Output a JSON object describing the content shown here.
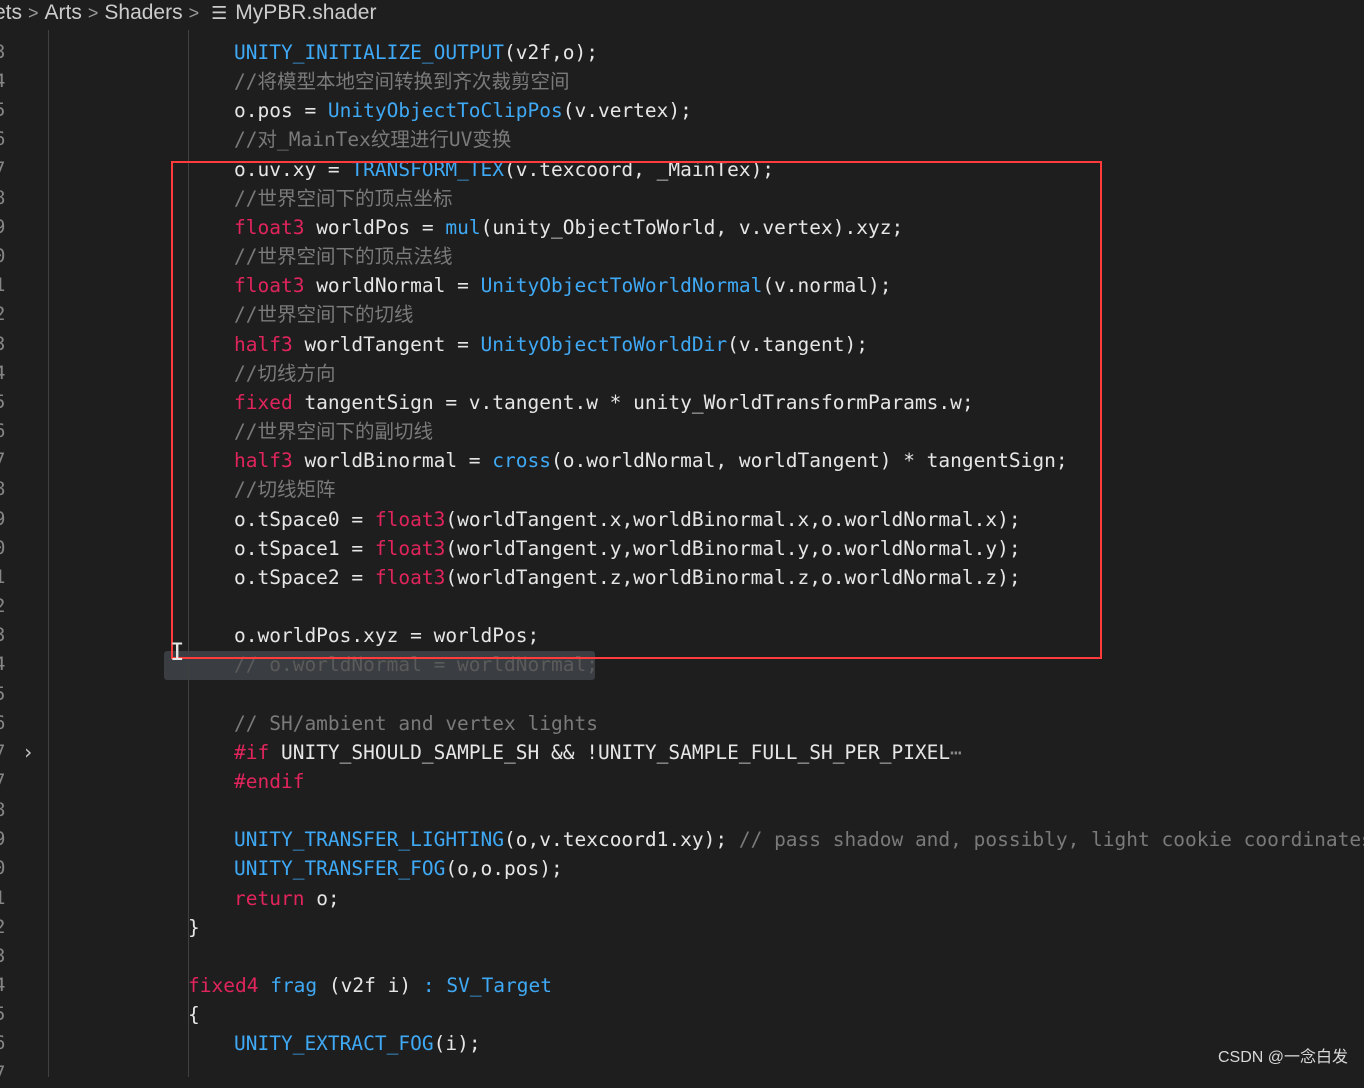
{
  "breadcrumb": {
    "items": [
      "ets",
      "Arts",
      "Shaders"
    ],
    "separator": ">",
    "file_icon": "list-file-icon",
    "file": "MyPBR.shader"
  },
  "gutter": {
    "numbers": [
      "3",
      "4",
      "5",
      "6",
      "7",
      "8",
      "9",
      "0",
      "1",
      "2",
      "3",
      "4",
      "5",
      "6",
      "7",
      "8",
      "9",
      "0",
      "1",
      "2",
      "3",
      "4",
      "5",
      "6",
      "7",
      "7",
      "8",
      "9",
      "0",
      "1",
      "2",
      "3",
      "4",
      "5",
      "6",
      "7"
    ],
    "fold_icon": "chevron-right-icon"
  },
  "code": {
    "lines": [
      [
        [
          "f",
          "UNITY_INITIALIZE_OUTPUT"
        ],
        [
          "p",
          "(v2f,o);"
        ]
      ],
      [
        [
          "c",
          "//将模型本地空间转换到齐次裁剪空间"
        ]
      ],
      [
        [
          "p",
          "o.pos = "
        ],
        [
          "f",
          "UnityObjectToClipPos"
        ],
        [
          "p",
          "(v.vertex);"
        ]
      ],
      [
        [
          "c",
          "//对_MainTex纹理进行UV变换"
        ]
      ],
      [
        [
          "p",
          "o.uv.xy = "
        ],
        [
          "f",
          "TRANSFORM_TEX"
        ],
        [
          "p",
          "(v.texcoord, _MainTex);"
        ]
      ],
      [
        [
          "c",
          "//世界空间下的顶点坐标"
        ]
      ],
      [
        [
          "k",
          "float3"
        ],
        [
          "p",
          " worldPos = "
        ],
        [
          "f",
          "mul"
        ],
        [
          "p",
          "(unity_ObjectToWorld, v.vertex).xyz;"
        ]
      ],
      [
        [
          "c",
          "//世界空间下的顶点法线"
        ]
      ],
      [
        [
          "k",
          "float3"
        ],
        [
          "p",
          " worldNormal = "
        ],
        [
          "f",
          "UnityObjectToWorldNormal"
        ],
        [
          "p",
          "(v.normal);"
        ]
      ],
      [
        [
          "c",
          "//世界空间下的切线"
        ]
      ],
      [
        [
          "k",
          "half3"
        ],
        [
          "p",
          " worldTangent = "
        ],
        [
          "f",
          "UnityObjectToWorldDir"
        ],
        [
          "p",
          "(v.tangent);"
        ]
      ],
      [
        [
          "c",
          "//切线方向"
        ]
      ],
      [
        [
          "k",
          "fixed"
        ],
        [
          "p",
          " tangentSign = v.tangent.w * unity_WorldTransformParams.w;"
        ]
      ],
      [
        [
          "c",
          "//世界空间下的副切线"
        ]
      ],
      [
        [
          "k",
          "half3"
        ],
        [
          "p",
          " worldBinormal = "
        ],
        [
          "f",
          "cross"
        ],
        [
          "p",
          "(o.worldNormal, worldTangent) * tangentSign;"
        ]
      ],
      [
        [
          "c",
          "//切线矩阵"
        ]
      ],
      [
        [
          "p",
          "o.tSpace0 = "
        ],
        [
          "k",
          "float3"
        ],
        [
          "p",
          "(worldTangent.x,worldBinormal.x,o.worldNormal.x);"
        ]
      ],
      [
        [
          "p",
          "o.tSpace1 = "
        ],
        [
          "k",
          "float3"
        ],
        [
          "p",
          "(worldTangent.y,worldBinormal.y,o.worldNormal.y);"
        ]
      ],
      [
        [
          "p",
          "o.tSpace2 = "
        ],
        [
          "k",
          "float3"
        ],
        [
          "p",
          "(worldTangent.z,worldBinormal.z,o.worldNormal.z);"
        ]
      ],
      [],
      [
        [
          "p",
          "o.worldPos.xyz = worldPos;"
        ]
      ],
      [
        [
          "d",
          "// o.worldNormal = worldNormal;"
        ]
      ],
      [],
      [
        [
          "c",
          "// SH/ambient and vertex lights"
        ]
      ],
      [
        [
          "k",
          "#if"
        ],
        [
          "p",
          " UNITY_SHOULD_SAMPLE_SH && !UNITY_SAMPLE_FULL_SH_PER_PIXEL"
        ],
        [
          "e",
          "⋯"
        ]
      ],
      [
        [
          "k",
          "#endif"
        ]
      ],
      [],
      [
        [
          "f",
          "UNITY_TRANSFER_LIGHTING"
        ],
        [
          "p",
          "(o,v.texcoord1.xy); "
        ],
        [
          "c",
          "// pass shadow and, possibly, light cookie coordinates"
        ]
      ],
      [
        [
          "f",
          "UNITY_TRANSFER_FOG"
        ],
        [
          "p",
          "(o,o.pos);"
        ]
      ],
      [
        [
          "k",
          "return"
        ],
        [
          "p",
          " o;"
        ]
      ],
      [
        [
          "p",
          "}"
        ]
      ],
      [],
      [
        [
          "k",
          "fixed4"
        ],
        [
          "p",
          " "
        ],
        [
          "f",
          "frag"
        ],
        [
          "p",
          " (v2f i) "
        ],
        [
          "f",
          ":"
        ],
        [
          "p",
          " "
        ],
        [
          "f",
          "SV_Target"
        ]
      ],
      [
        [
          "p",
          "{"
        ]
      ],
      [
        [
          "f",
          "UNITY_EXTRACT_FOG"
        ],
        [
          "p",
          "(i);"
        ]
      ]
    ]
  },
  "colors": {
    "background": "#1e1e1e",
    "function": "#3fa9f5",
    "keyword": "#e0245c",
    "comment": "#7a7a7a",
    "annotation_box": "#ff3b3b"
  },
  "watermark": "CSDN @一念白发"
}
